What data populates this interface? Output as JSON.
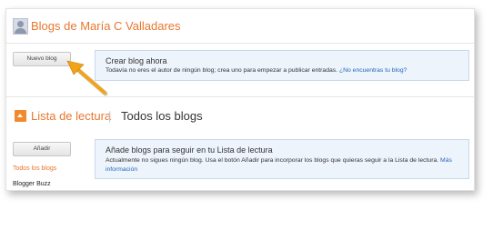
{
  "header": {
    "title": "Blogs de María C Valladares"
  },
  "blogs": {
    "new_blog_button": "Nuevo blog",
    "create_title": "Crear blog ahora",
    "create_text": "Todavía no eres el autor de ningún blog; crea uno para empezar a publicar entradas.",
    "create_link": "¿No encuentras tu blog?"
  },
  "reading": {
    "title": "Lista de lectura",
    "separator": "|",
    "subtitle": "Todos los blogs",
    "add_button": "Añadir",
    "info_title": "Añade blogs para seguir en tu Lista de lectura",
    "info_text_line1": "Actualmente no sigues ningún blog. Usa el botón Añadir para incorporar los blogs que quieras seguir a la Lista de",
    "info_text_line2": "lectura.",
    "info_link": "Más información",
    "sidebar": [
      {
        "label": "Todos los blogs",
        "color": "#e8772e"
      },
      {
        "label": "Blogger Buzz",
        "color": "#222222"
      }
    ]
  },
  "colors": {
    "accent": "#e8772e",
    "link": "#2266bb",
    "annotation_arrow": "#f2a31a"
  }
}
